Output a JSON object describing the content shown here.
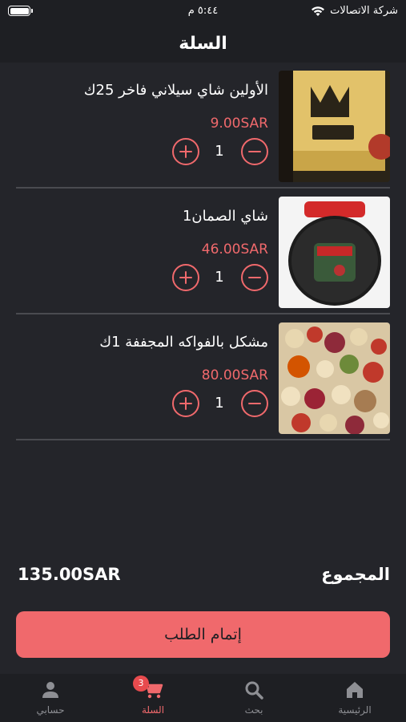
{
  "status_bar": {
    "carrier": "شركة الاتصالات",
    "time": "٥:٤٤ م"
  },
  "header": {
    "title": "السلة"
  },
  "cart": {
    "items": [
      {
        "name": "الأولين شاي سيلاني فاخر 25ك",
        "price": "9.00SAR",
        "quantity": "1",
        "image": "tea-box-image"
      },
      {
        "name": "شاي الصمان1",
        "price": "46.00SAR",
        "quantity": "1",
        "image": "tea-jar-image"
      },
      {
        "name": "مشكل بالفواكه المجففة 1ك",
        "price": "80.00SAR",
        "quantity": "1",
        "image": "dried-fruits-image"
      }
    ]
  },
  "summary": {
    "total_label": "المجموع",
    "total_value": "135.00SAR",
    "checkout_label": "إتمام الطلب"
  },
  "tabs": [
    {
      "label": "الرئيسية",
      "icon": "home-icon"
    },
    {
      "label": "بحث",
      "icon": "search-icon"
    },
    {
      "label": "السلة",
      "icon": "cart-icon",
      "badge": "3",
      "active": true
    },
    {
      "label": "حسابي",
      "icon": "person-icon"
    }
  ],
  "colors": {
    "accent": "#f0696c",
    "background": "#1e1f23",
    "content_background": "#24252a",
    "divider": "#4a4b50"
  }
}
